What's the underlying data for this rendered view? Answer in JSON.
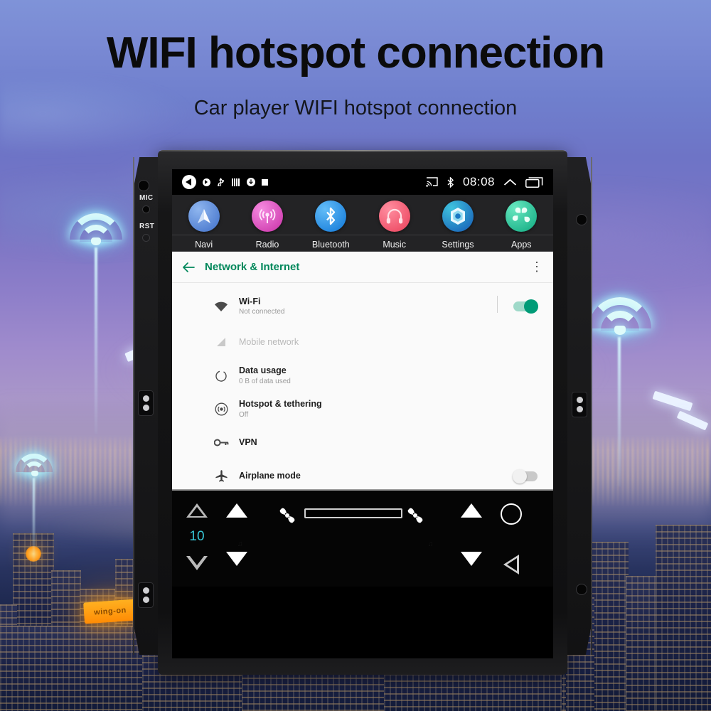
{
  "page": {
    "headline": "WIFI hotspot connection",
    "subhead": "Car player WIFI hotspot connection"
  },
  "background": {
    "neon_sign_text": "wing-on",
    "wifi_glyphs": 3,
    "accent_glow": "#dffbfa"
  },
  "device": {
    "left_bezel": {
      "mic_label": "MIC",
      "rst_label": "RST"
    }
  },
  "statusbar": {
    "left_icons": [
      "volume-mute-icon",
      "location-icon",
      "usb-icon",
      "equalizer-icon",
      "download-icon",
      "stop-icon"
    ],
    "cast_icon": "cast-icon",
    "bluetooth_icon": "bluetooth-icon",
    "clock": "08:08",
    "collapse_icon": "chevron-up-icon",
    "recents_icon": "recents-icon"
  },
  "dock": {
    "items": [
      {
        "label": "Navi",
        "icon": "navigation-icon",
        "color": "#4a7fd4",
        "color2": "#7aa7e8"
      },
      {
        "label": "Radio",
        "icon": "radio-tower-icon",
        "color": "#d13bb0",
        "color2": "#ef7ad8"
      },
      {
        "label": "Bluetooth",
        "icon": "bluetooth-icon",
        "color": "#1b86e0",
        "color2": "#55b4f5"
      },
      {
        "label": "Music",
        "icon": "headphones-icon",
        "color": "#ef4b63",
        "color2": "#fa8193"
      },
      {
        "label": "Settings",
        "icon": "gear-hex-icon",
        "color": "#1565c0",
        "color2": "#39b9d6"
      },
      {
        "label": "Apps",
        "icon": "apps-grid-icon",
        "color": "#12b38c",
        "color2": "#56e0b8"
      }
    ]
  },
  "settings": {
    "back_icon": "back-arrow-icon",
    "title": "Network & Internet",
    "overflow_icon": "more-vertical-icon",
    "accent_color": "#00875a",
    "rows": [
      {
        "icon": "wifi-icon",
        "title": "Wi-Fi",
        "subtitle": "Not connected",
        "dim": false,
        "toggle": "on",
        "divider": true
      },
      {
        "icon": "signal-icon",
        "title": "Mobile network",
        "subtitle": "",
        "dim": true,
        "toggle": null,
        "divider": false
      },
      {
        "icon": "datausage-icon",
        "title": "Data usage",
        "subtitle": "0 B of data used",
        "dim": false,
        "toggle": null,
        "divider": false
      },
      {
        "icon": "hotspot-icon",
        "title": "Hotspot & tethering",
        "subtitle": "Off",
        "dim": false,
        "toggle": null,
        "divider": false
      },
      {
        "icon": "key-icon",
        "title": "VPN",
        "subtitle": "",
        "dim": false,
        "toggle": null,
        "divider": false
      },
      {
        "icon": "airplane-icon",
        "title": "Airplane mode",
        "subtitle": "",
        "dim": false,
        "toggle": "off",
        "divider": false
      }
    ]
  },
  "hvac": {
    "temp_value": "10",
    "temp_color": "#37c8d8",
    "left_up_icon": "temp-up-outline-icon",
    "left_down_icon": "temp-down-outline-icon",
    "fan_left_icon": "fan-icon",
    "fan_right_icon": "fan-icon",
    "slider_name": "fan-speed-slider",
    "home_icon": "home-circle-icon",
    "back_icon": "back-triangle-icon"
  }
}
